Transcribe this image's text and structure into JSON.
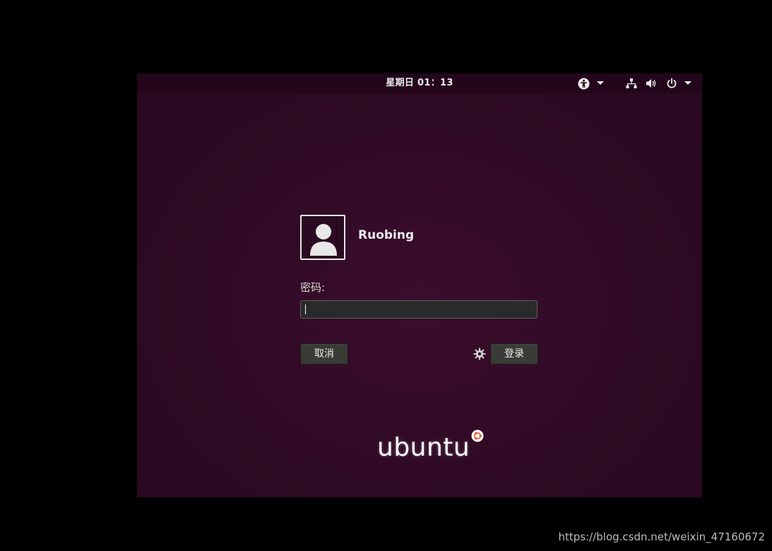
{
  "topbar": {
    "clock": "星期日 01：13",
    "icons": {
      "accessibility": "accessibility-icon",
      "accessibility_menu": "chevron-down-icon",
      "network": "network-wired-icon",
      "volume": "volume-icon",
      "power": "power-icon",
      "system_menu": "chevron-down-icon"
    }
  },
  "login": {
    "avatar_icon": "user-avatar-icon",
    "username": "Ruobing",
    "password_label": "密码:",
    "password_value": "",
    "cancel_label": "取消",
    "login_label": "登录",
    "session_icon": "gear-icon"
  },
  "branding": {
    "logo_text": "ubuntu",
    "logo_icon": "ubuntu-circle-of-friends-icon"
  },
  "watermark": {
    "text": "https://blog.csdn.net/weixin_47160672"
  },
  "colors": {
    "background": "#2f0a24",
    "topbar": "#24061c",
    "button": "#3a3a37",
    "input": "#2a2a2a",
    "logo_accent": "#e95420"
  }
}
